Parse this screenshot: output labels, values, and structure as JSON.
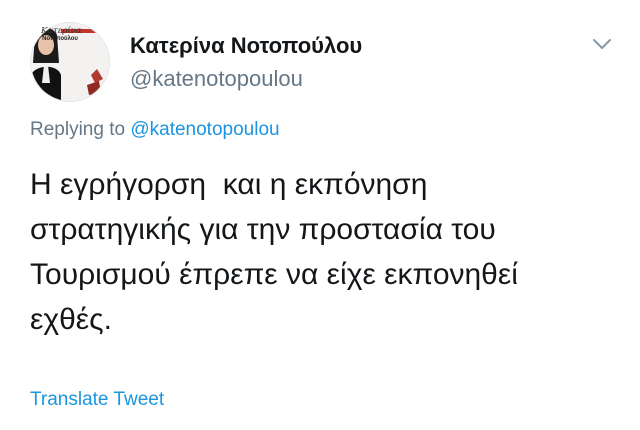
{
  "author": {
    "display_name": "Κατερίνα Νοτοπούλου",
    "handle": "@katenotopoulou",
    "avatar": {
      "name_line1": "Κατερίνα",
      "name_line2": "Νοτοπούλου"
    }
  },
  "reply": {
    "prefix": "Replying to ",
    "mention": "@katenotopoulou"
  },
  "tweet": {
    "text": "Η εγρήγορση  και η εκπόνηση\nστρατηγικής για την προστασία του\nΤουρισμού έπρεπε να είχε εκπονηθεί\nεχθές."
  },
  "actions": {
    "translate_label": "Translate Tweet",
    "menu_icon": "chevron-down-icon"
  },
  "colors": {
    "text": "#14171a",
    "secondary": "#657786",
    "link": "#1b95e0"
  }
}
